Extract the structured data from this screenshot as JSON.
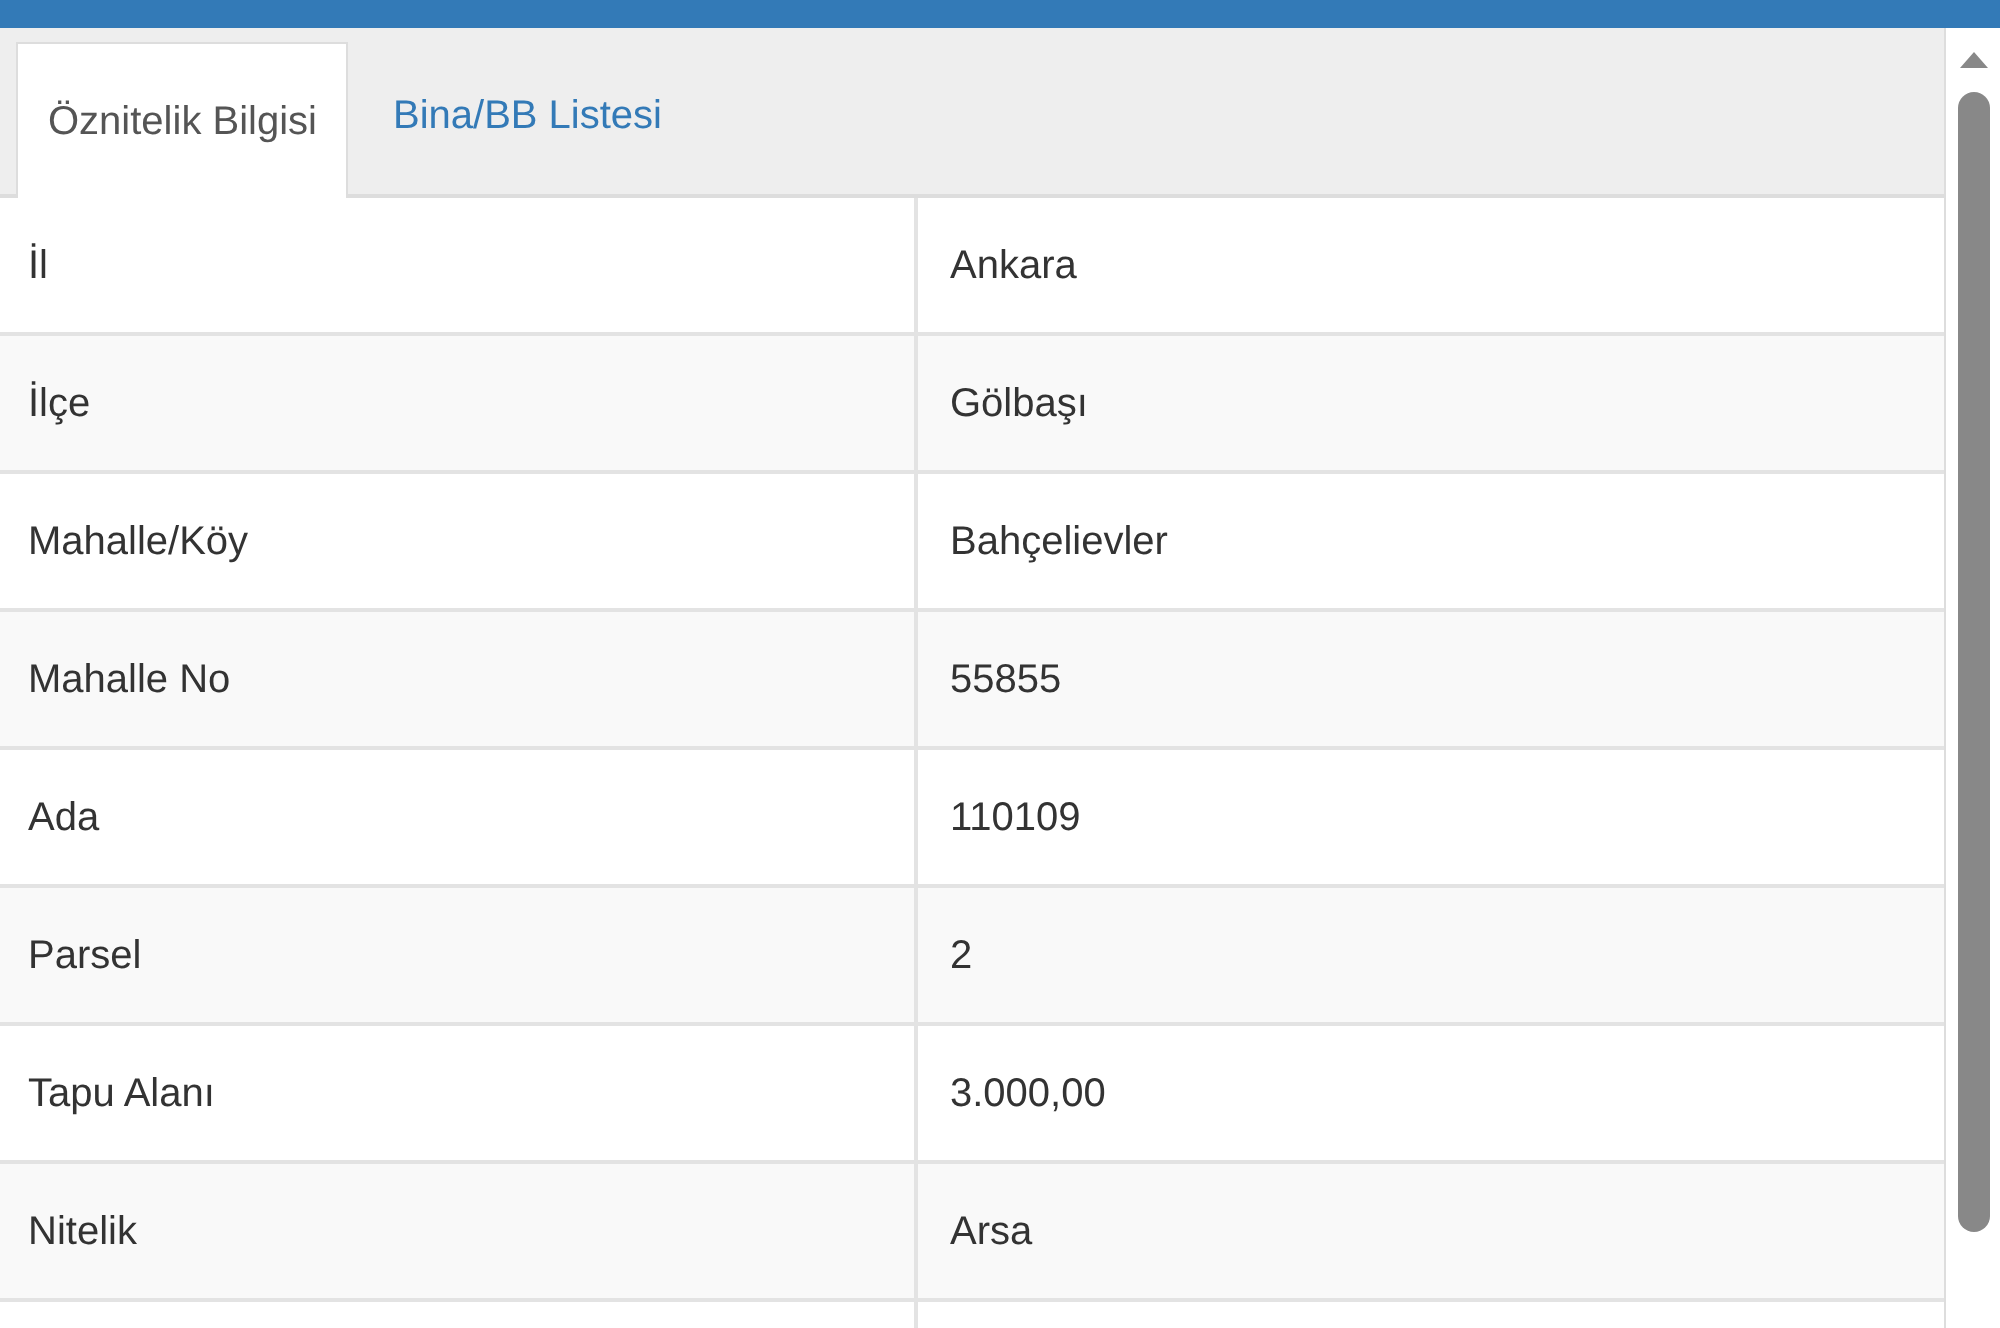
{
  "tabs": [
    {
      "label": "Öznitelik Bilgisi",
      "selected": true
    },
    {
      "label": "Bina/BB Listesi",
      "selected": false
    }
  ],
  "table": {
    "rows": [
      {
        "label": "İl",
        "value": "Ankara"
      },
      {
        "label": "İlçe",
        "value": "Gölbaşı"
      },
      {
        "label": "Mahalle/Köy",
        "value": "Bahçelievler"
      },
      {
        "label": "Mahalle No",
        "value": "55855"
      },
      {
        "label": "Ada",
        "value": "110109"
      },
      {
        "label": "Parsel",
        "value": "2"
      },
      {
        "label": "Tapu Alanı",
        "value": "3.000,00"
      },
      {
        "label": "Nitelik",
        "value": "Arsa"
      }
    ]
  }
}
